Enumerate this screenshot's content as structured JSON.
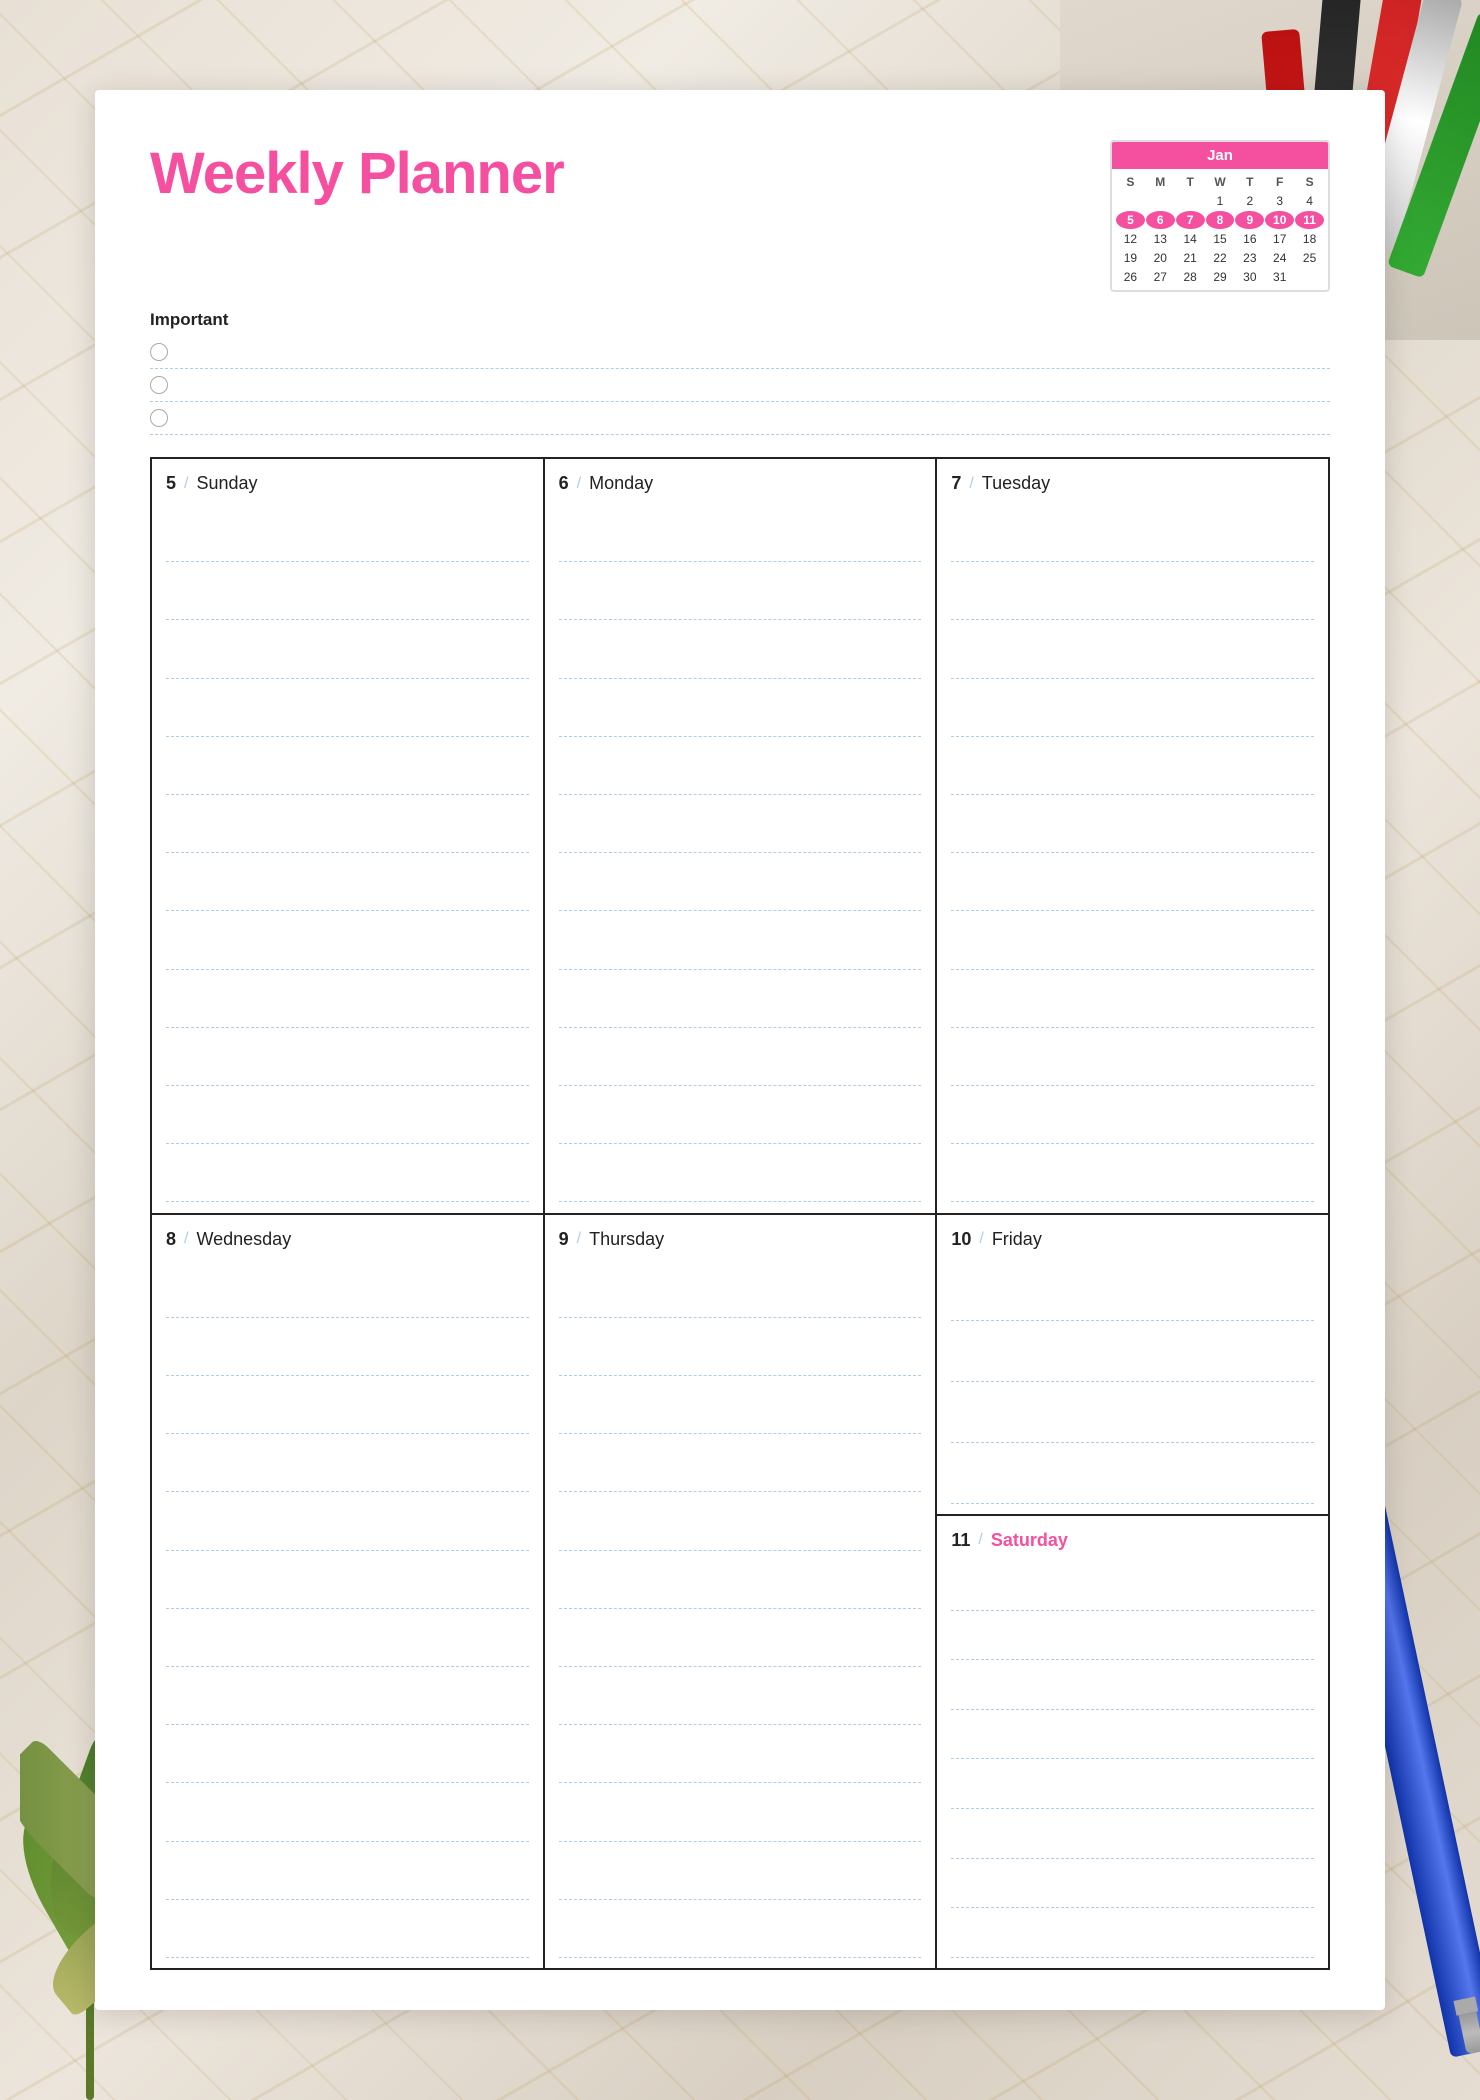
{
  "title": "Weekly Planner",
  "mini_calendar": {
    "month": "January",
    "month_short": "Jan",
    "day_headers": [
      "S",
      "M",
      "T",
      "W",
      "T",
      "F",
      "S"
    ],
    "weeks": [
      [
        "",
        "",
        "",
        "1",
        "2",
        "3",
        "4"
      ],
      [
        "5",
        "6",
        "7",
        "8",
        "9",
        "10",
        "11"
      ],
      [
        "12",
        "13",
        "14",
        "15",
        "16",
        "17",
        "18"
      ],
      [
        "19",
        "20",
        "21",
        "22",
        "23",
        "24",
        "25"
      ],
      [
        "26",
        "27",
        "28",
        "29",
        "30",
        "31",
        ""
      ]
    ],
    "highlighted": [
      "5",
      "6",
      "7",
      "8",
      "9",
      "10",
      "11"
    ]
  },
  "important_label": "Important",
  "important_items": [
    {
      "id": 1,
      "text": ""
    },
    {
      "id": 2,
      "text": ""
    },
    {
      "id": 3,
      "text": ""
    }
  ],
  "days": [
    {
      "number": "5",
      "name": "Sunday",
      "special": false
    },
    {
      "number": "6",
      "name": "Monday",
      "special": false
    },
    {
      "number": "7",
      "name": "Tuesday",
      "special": false
    },
    {
      "number": "8",
      "name": "Wednesday",
      "special": false
    },
    {
      "number": "9",
      "name": "Thursday",
      "special": false
    },
    {
      "number": "10",
      "name": "Friday",
      "special": false
    },
    {
      "number": "11",
      "name": "Saturday",
      "special": true
    }
  ],
  "slash": "/",
  "lines_per_day": 12,
  "lines_friday": 4,
  "lines_saturday": 8
}
